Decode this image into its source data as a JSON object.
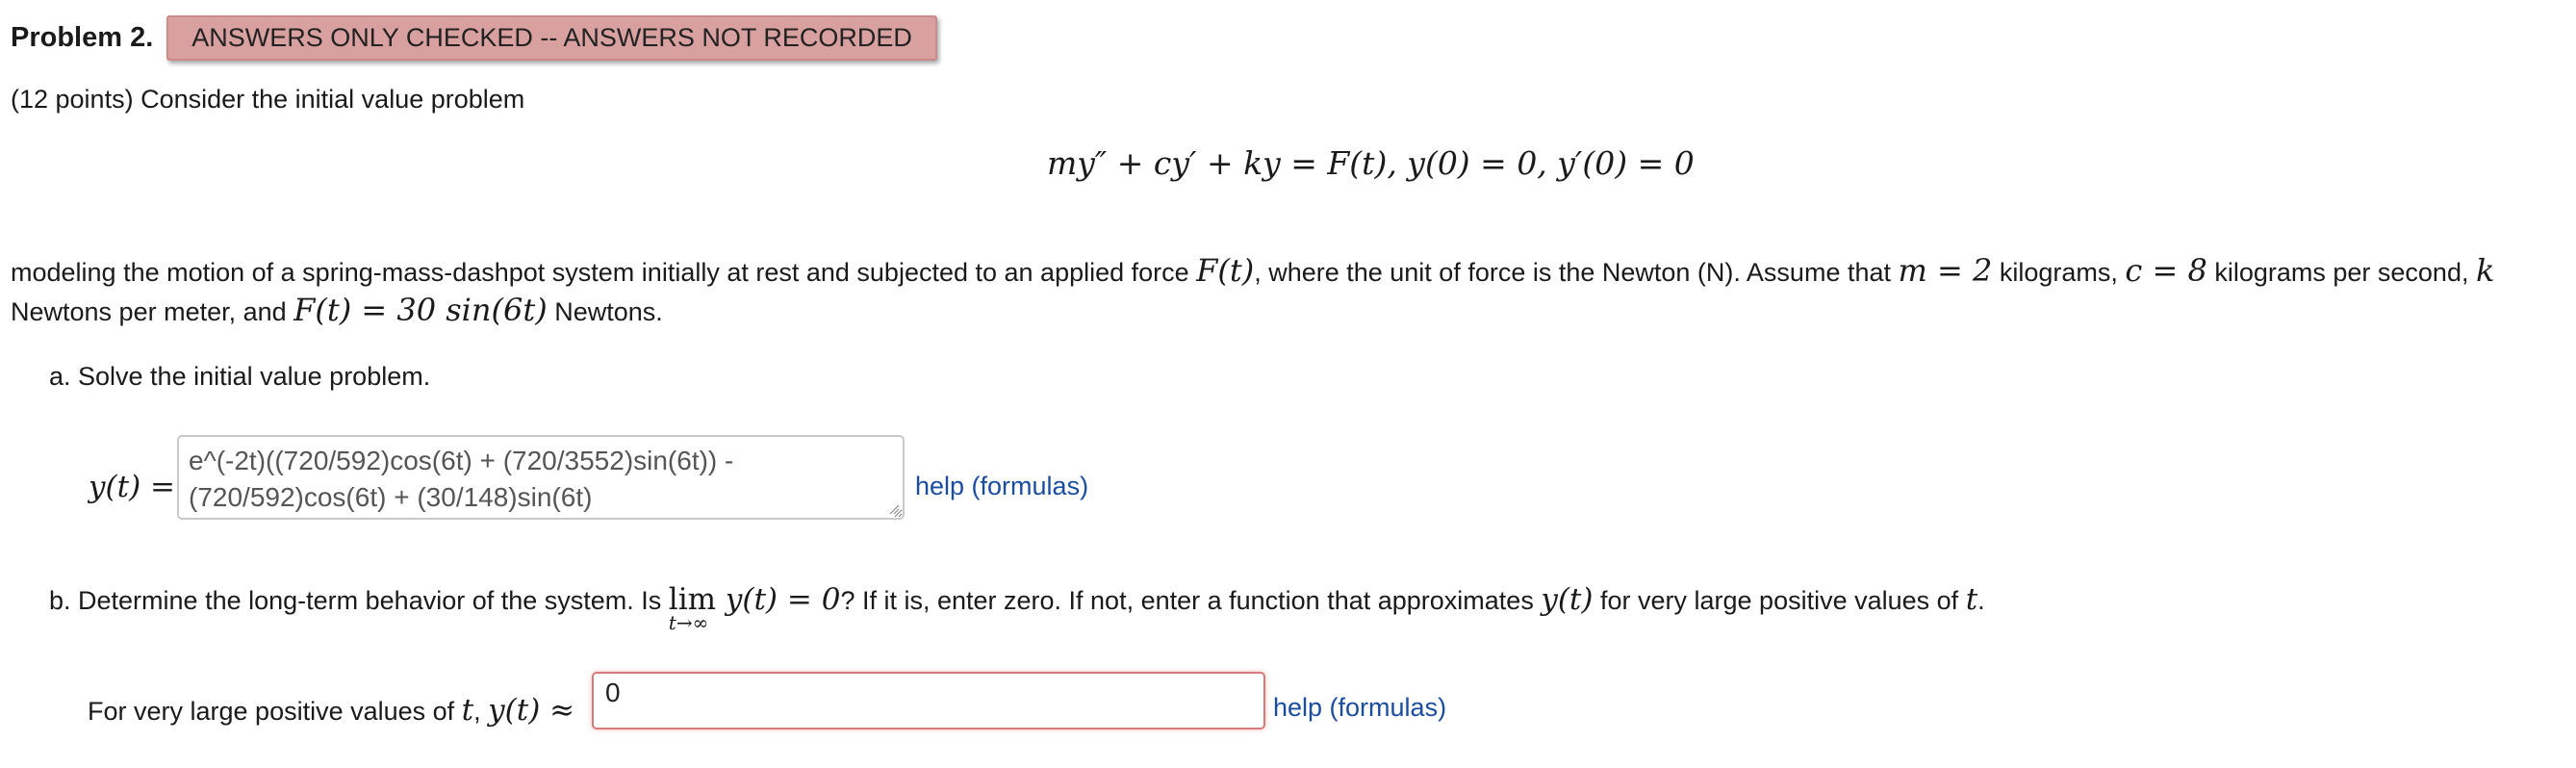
{
  "header": {
    "title": "Problem 2.",
    "status_badge": "ANSWERS ONLY CHECKED -- ANSWERS NOT RECORDED"
  },
  "intro": "(12 points) Consider the initial value problem",
  "equation": "my″ + cy′ + ky = F(t),   y(0) = 0,   y′(0) = 0",
  "paragraph": {
    "text1": "modeling the motion of a spring-mass-dashpot system initially at rest and subjected to an applied force ",
    "ft": "F(t)",
    "text2": ", where the unit of force is the Newton (N). Assume that ",
    "m_eq": "m = 2",
    "text3": " kilograms, ",
    "c_eq": "c = 8",
    "text4": " kilograms per second, ",
    "k_var": "k",
    "line2_start": "Newtons per meter, and ",
    "force_eq": "F(t) = 30 sin(6t)",
    "line2_end": " Newtons."
  },
  "part_a": {
    "label": "a.  Solve the initial value problem.",
    "y_label": "y(t) =",
    "answer_value": "e^(-2t)((720/592)cos(6t) + (720/3552)sin(6t)) - (720/592)cos(6t) + (30/148)sin(6t)",
    "help_label": "help (formulas)"
  },
  "part_b": {
    "label_start": "b.  Determine the long-term behavior of the system. Is ",
    "lim": "lim",
    "lim_sub": "t→∞",
    "lim_expr": " y(t) = 0",
    "label_mid": "? If it is, enter zero. If not, enter a function that approximates ",
    "yt": "y(t)",
    "label_end": " for very large positive values of ",
    "t": "t",
    "period": ".",
    "prompt_start": "For very large positive values of ",
    "prompt_t": "t",
    "prompt_sep": ", ",
    "prompt_approx": "y(t) ≈",
    "answer_value": "0",
    "help_label": "help (formulas)"
  },
  "colors": {
    "badge_bg": "#d9a0a0",
    "link": "#1a4da0",
    "error_border": "#d97a7a"
  }
}
